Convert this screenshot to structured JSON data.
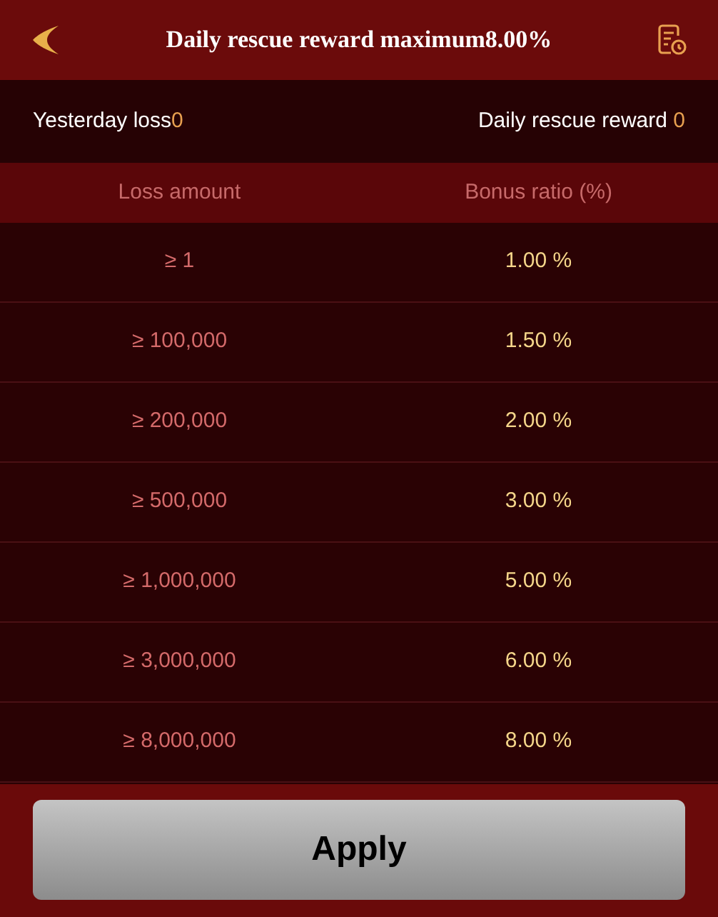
{
  "header": {
    "title": "Daily rescue reward maximum8.00%"
  },
  "summary": {
    "loss_label": "Yesterday loss",
    "loss_value": "0",
    "reward_label": "Daily rescue reward ",
    "reward_value": "0"
  },
  "table": {
    "columns": [
      "Loss amount",
      "Bonus ratio (%)"
    ],
    "rows": [
      {
        "amount": "≥ 1",
        "ratio": "1.00 %"
      },
      {
        "amount": "≥ 100,000",
        "ratio": "1.50 %"
      },
      {
        "amount": "≥ 200,000",
        "ratio": "2.00 %"
      },
      {
        "amount": "≥ 500,000",
        "ratio": "3.00 %"
      },
      {
        "amount": "≥ 1,000,000",
        "ratio": "5.00 %"
      },
      {
        "amount": "≥ 3,000,000",
        "ratio": "6.00 %"
      },
      {
        "amount": "≥ 8,000,000",
        "ratio": "8.00 %"
      }
    ]
  },
  "apply_button": "Apply"
}
